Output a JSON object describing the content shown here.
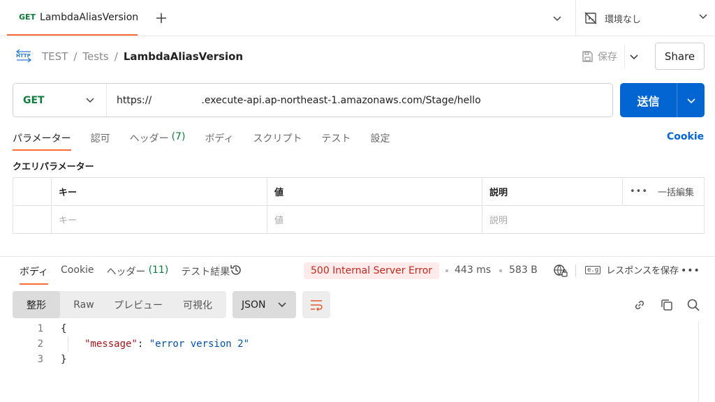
{
  "tabbar": {
    "method": "GET",
    "tab_name": "LambdaAliasVersion",
    "environment": "環境なし"
  },
  "breadcrumb": {
    "items": [
      "TEST",
      "Tests"
    ],
    "current": "LambdaAliasVersion"
  },
  "actions": {
    "save_label": "保存",
    "share_label": "Share"
  },
  "request": {
    "method": "GET",
    "url": "https://                .execute-api.ap-northeast-1.amazonaws.com/Stage/hello",
    "send_label": "送信",
    "tabs": [
      {
        "label": "パラメーター"
      },
      {
        "label": "認可"
      },
      {
        "label": "ヘッダー",
        "count": "(7)"
      },
      {
        "label": "ボディ"
      },
      {
        "label": "スクリプト"
      },
      {
        "label": "テスト"
      },
      {
        "label": "設定"
      }
    ],
    "cookie_label": "Cookie"
  },
  "params": {
    "title": "クエリパラメーター",
    "headers": {
      "key": "キー",
      "value": "値",
      "description": "説明",
      "bulk_edit": "一括編集"
    },
    "placeholders": {
      "key": "キー",
      "value": "値",
      "description": "説明"
    }
  },
  "response": {
    "tabs": [
      {
        "label": "ボディ"
      },
      {
        "label": "Cookie"
      },
      {
        "label": "ヘッダー",
        "count": "(11)"
      },
      {
        "label": "テスト結果"
      }
    ],
    "status": "500 Internal Server Error",
    "time": "443 ms",
    "size": "583 B",
    "save_response_label": "レスポンスを保存",
    "eg_badge": "e.g",
    "formats": [
      "整形",
      "Raw",
      "プレビュー",
      "可視化"
    ],
    "language": "JSON",
    "body_lines": [
      {
        "n": "1",
        "text": "{"
      },
      {
        "n": "2",
        "key": "\"message\"",
        "colon": ": ",
        "value": "\"error version 2\""
      },
      {
        "n": "3",
        "text": "}"
      }
    ]
  },
  "colors": {
    "accent": "#ff6c37",
    "send": "#0265d2",
    "method_get": "#0f7b3c",
    "error_bg": "#fdeaea",
    "error_text": "#c4281c"
  },
  "icons": [
    "plus-icon",
    "chevron-down-icon",
    "no-environment-icon",
    "http-icon",
    "save-icon",
    "history-icon",
    "globe-lock-icon",
    "more-icon",
    "wrap-icon",
    "link-icon",
    "copy-icon",
    "search-icon"
  ]
}
